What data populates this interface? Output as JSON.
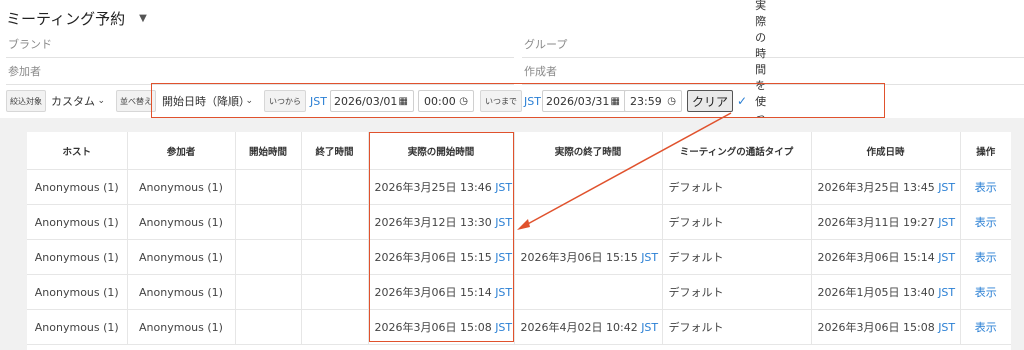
{
  "page": {
    "title": "ミーティング予約"
  },
  "filters": {
    "brand_placeholder": "ブランド",
    "group_placeholder": "グループ",
    "participant_placeholder": "参加者",
    "creator_placeholder": "作成者"
  },
  "toolbar": {
    "filter_target_tag": "絞込対象",
    "filter_target_value": "カスタム",
    "sort_tag": "並べ替え",
    "sort_value": "開始日時（降順）",
    "from_tag": "いつから",
    "from_tz": "JST",
    "from_date": "2026/03/01",
    "from_time": "00:00",
    "to_tag": "いつまで",
    "to_tz": "JST",
    "to_date": "2026/03/31",
    "to_time": "23:59",
    "clear_label": "クリア",
    "actual_time_label": "実際の時間を使って絞り込む"
  },
  "table": {
    "headers": [
      "ホスト",
      "参加者",
      "開始時間",
      "終了時間",
      "実際の開始時間",
      "実際の終了時間",
      "ミーティングの通話タイプ",
      "作成日時",
      "操作"
    ],
    "tz": "JST",
    "action_label": "表示",
    "rows": [
      {
        "host": "Anonymous (1)",
        "participant": "Anonymous (1)",
        "start": "",
        "end": "",
        "actual_start": "2026年3月25日 13:46",
        "actual_end": "",
        "call_type": "デフォルト",
        "created": "2026年3月25日 13:45"
      },
      {
        "host": "Anonymous (1)",
        "participant": "Anonymous (1)",
        "start": "",
        "end": "",
        "actual_start": "2026年3月12日 13:30",
        "actual_end": "",
        "call_type": "デフォルト",
        "created": "2026年3月11日 19:27"
      },
      {
        "host": "Anonymous (1)",
        "participant": "Anonymous (1)",
        "start": "",
        "end": "",
        "actual_start": "2026年3月06日 15:15",
        "actual_end": "2026年3月06日 15:15",
        "call_type": "デフォルト",
        "created": "2026年3月06日 15:14"
      },
      {
        "host": "Anonymous (1)",
        "participant": "Anonymous (1)",
        "start": "",
        "end": "",
        "actual_start": "2026年3月06日 15:14",
        "actual_end": "",
        "call_type": "デフォルト",
        "created": "2026年1月05日 13:40"
      },
      {
        "host": "Anonymous (1)",
        "participant": "Anonymous (1)",
        "start": "",
        "end": "",
        "actual_start": "2026年3月06日 15:08",
        "actual_end": "2026年4月02日 10:42",
        "call_type": "デフォルト",
        "created": "2026年3月06日 15:08"
      }
    ]
  },
  "colors": {
    "accent": "#2a7fd4",
    "highlight": "#e0522d"
  }
}
